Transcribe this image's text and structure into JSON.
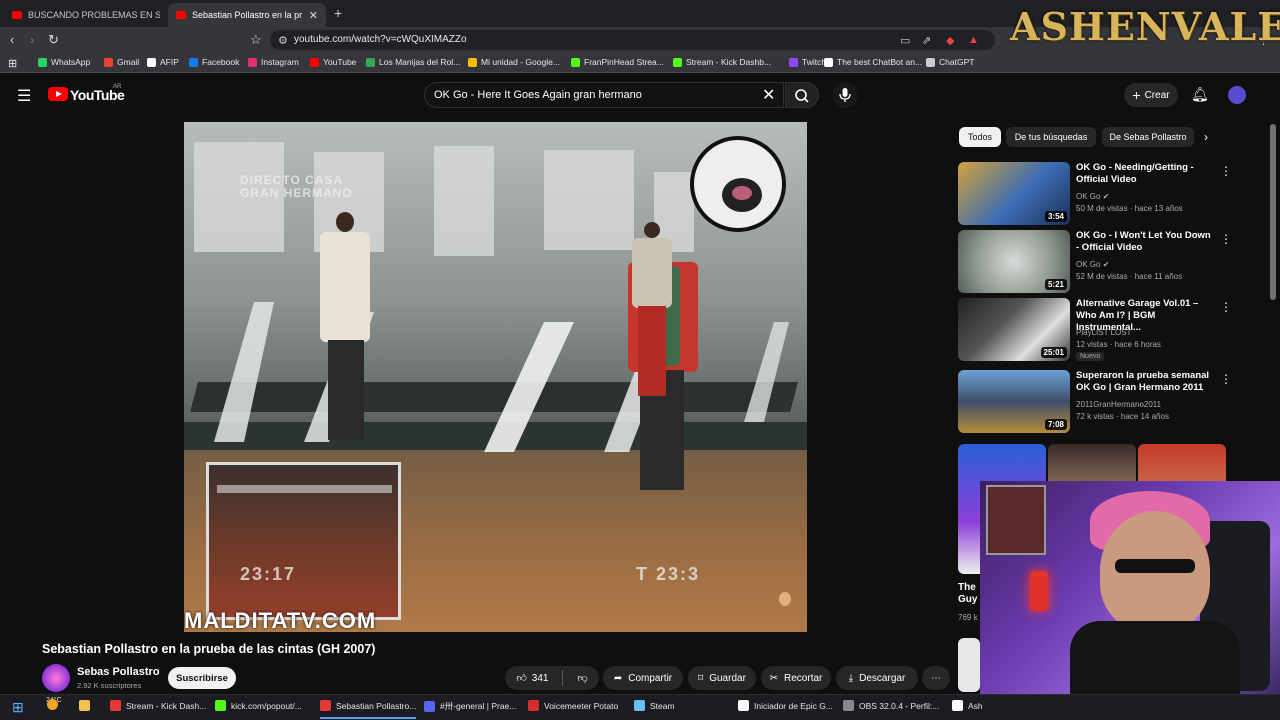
{
  "browser": {
    "tabs": [
      {
        "label": "BUSCANDO PROBLEMAS EN SHANG",
        "active": false
      },
      {
        "label": "Sebastian Pollastro en la prue",
        "active": true
      }
    ],
    "url": "youtube.com/watch?v=cWQuXIMAZZo",
    "bookmarks": [
      {
        "label": "WhatsApp",
        "color": "#25d366"
      },
      {
        "label": "Gmail",
        "color": "#ea4335"
      },
      {
        "label": "AFIP",
        "color": "#ffffff"
      },
      {
        "label": "Facebook",
        "color": "#1877f2"
      },
      {
        "label": "Instagram",
        "color": "#e1306c"
      },
      {
        "label": "YouTube",
        "color": "#ff0000"
      },
      {
        "label": "Los Manijas del Rol...",
        "color": "#34a853"
      },
      {
        "label": "Mi unidad - Google...",
        "color": "#fbbc04"
      },
      {
        "label": "FranPinHead Strea...",
        "color": "#53fc18"
      },
      {
        "label": "Stream - Kick Dashb...",
        "color": "#53fc18"
      },
      {
        "label": "Twitch",
        "color": "#9146ff"
      },
      {
        "label": "The best ChatBot an...",
        "color": "#ffffff"
      },
      {
        "label": "ChatGPT",
        "color": "#cccccc"
      }
    ]
  },
  "brand_logo": "ASHENVALE",
  "youtube": {
    "logo_text": "YouTube",
    "region": "AR",
    "search_query": "OK Go - Here It Goes Again gran hermano",
    "create_label": "Crear"
  },
  "video": {
    "title": "Sebastian Pollastro en la prueba de las cintas (GH 2007)",
    "overlay_top": "DIRECTO CASA\nGRAN HERMANO",
    "overlay_left_number": "23:17",
    "overlay_right_number": "T 23:3",
    "watermark": "MALDITATV.COM"
  },
  "channel": {
    "name": "Sebas Pollastro",
    "subscribers": "2.92 K suscriptores",
    "subscribe_label": "Suscribirse"
  },
  "actions": {
    "likes": "341",
    "share": "Compartir",
    "save": "Guardar",
    "clip": "Recortar",
    "download": "Descargar"
  },
  "chips": [
    "Todos",
    "De tus búsquedas",
    "De Sebas Pollastro"
  ],
  "recommendations": [
    {
      "title": "OK Go - Needing/Getting - Official Video",
      "channel": "OK Go",
      "views": "50 M de vistas · hace 13 años",
      "duration": "3:54",
      "badge": ""
    },
    {
      "title": "OK Go - I Won't Let You Down - Official Video",
      "channel": "OK Go",
      "views": "52 M de vistas · hace 11 años",
      "duration": "5:21",
      "badge": ""
    },
    {
      "title": "Alternative Garage Vol.01 – Who Am I? | BGM Instrumental...",
      "channel": "PlayLIST LOST",
      "views": "12 vistas · hace 6 horas",
      "duration": "25:01",
      "badge": "Nuevo"
    },
    {
      "title": "Superaron la prueba semanal OK Go | Gran Hermano 2011",
      "channel": "2011GranHermano2011",
      "views": "72 k vistas · hace 14 años",
      "duration": "7:08",
      "badge": ""
    }
  ],
  "partial_reco": {
    "title_fragment": "The\nGuy",
    "views_fragment": "769 k"
  },
  "taskbar": {
    "weather": "24°C",
    "items": [
      {
        "label": "Stream - Kick Dash...",
        "color": "#e53935",
        "active": false
      },
      {
        "label": "kick.com/popout/...",
        "color": "#53fc18",
        "active": false
      },
      {
        "label": "Sebastian Pollastro...",
        "color": "#e53935",
        "active": true
      },
      {
        "label": "#卅-general | Prae...",
        "color": "#5865f2",
        "active": false
      },
      {
        "label": "Voicemeeter Potato",
        "color": "#d32f2f",
        "active": false
      },
      {
        "label": "Steam",
        "color": "#66c0f4",
        "active": false
      },
      {
        "label": "Iniciador de Epic G...",
        "color": "#ffffff",
        "active": false
      },
      {
        "label": "OBS 32.0.4 - Perfil:...",
        "color": "#888888",
        "active": false
      },
      {
        "label": "Ash",
        "color": "#ffffff",
        "active": false
      }
    ]
  }
}
